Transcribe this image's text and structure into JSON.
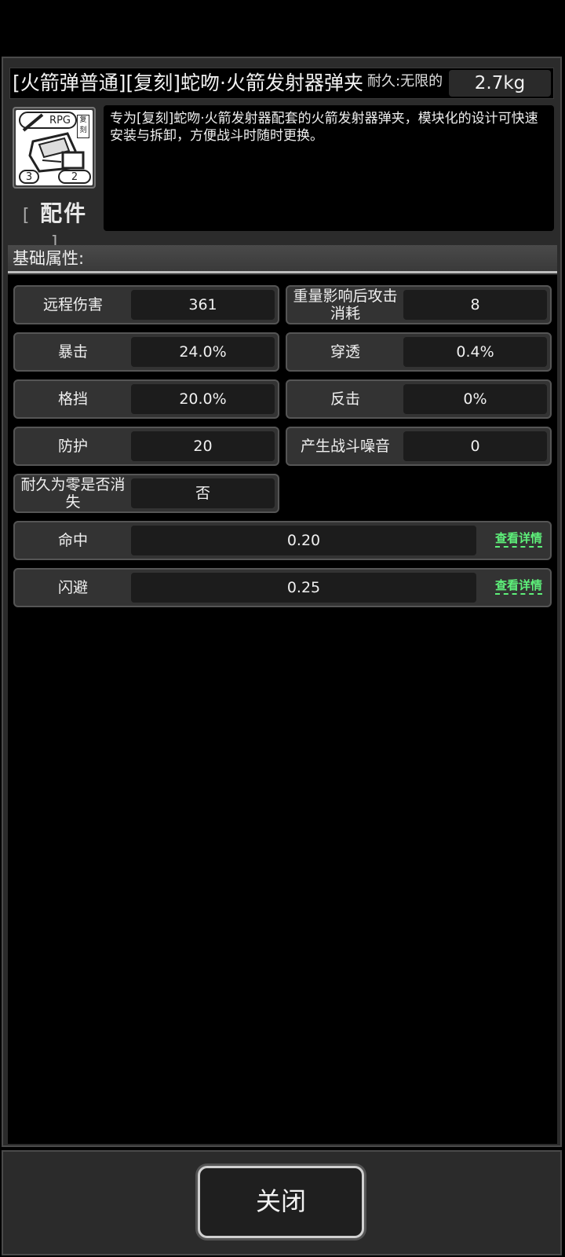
{
  "item": {
    "title": "[火箭弹普通][复刻]蛇吻·火箭发射器弹夹",
    "durability_label": "耐久:无限的",
    "weight": "2.7kg",
    "icon_badge": "RPG",
    "icon_stamp": "复刻",
    "icon_level_left": "3",
    "icon_level_right": "2",
    "category": "配件",
    "category_open": "[",
    "category_close": "]",
    "description": "专为[复刻]蛇吻·火箭发射器配套的火箭发射器弹夹，模块化的设计可快速安装与拆卸，方便战斗时随时更换。"
  },
  "section": {
    "title": "基础属性:"
  },
  "stats": {
    "ranged_damage": {
      "label": "远程伤害",
      "value": "361"
    },
    "weight_cost": {
      "label": "重量影响后攻击消耗",
      "value": "8"
    },
    "crit": {
      "label": "暴击",
      "value": "24.0%"
    },
    "penetration": {
      "label": "穿透",
      "value": "0.4%"
    },
    "block": {
      "label": "格挡",
      "value": "20.0%"
    },
    "counter": {
      "label": "反击",
      "value": "0%"
    },
    "defense": {
      "label": "防护",
      "value": "20"
    },
    "noise": {
      "label": "产生战斗噪音",
      "value": "0"
    },
    "vanish": {
      "label": "耐久为零是否消失",
      "value": "否"
    },
    "hit": {
      "label": "命中",
      "value": "0.20",
      "detail": "查看详情"
    },
    "dodge": {
      "label": "闪避",
      "value": "0.25",
      "detail": "查看详情"
    }
  },
  "footer": {
    "close_label": "关闭"
  }
}
